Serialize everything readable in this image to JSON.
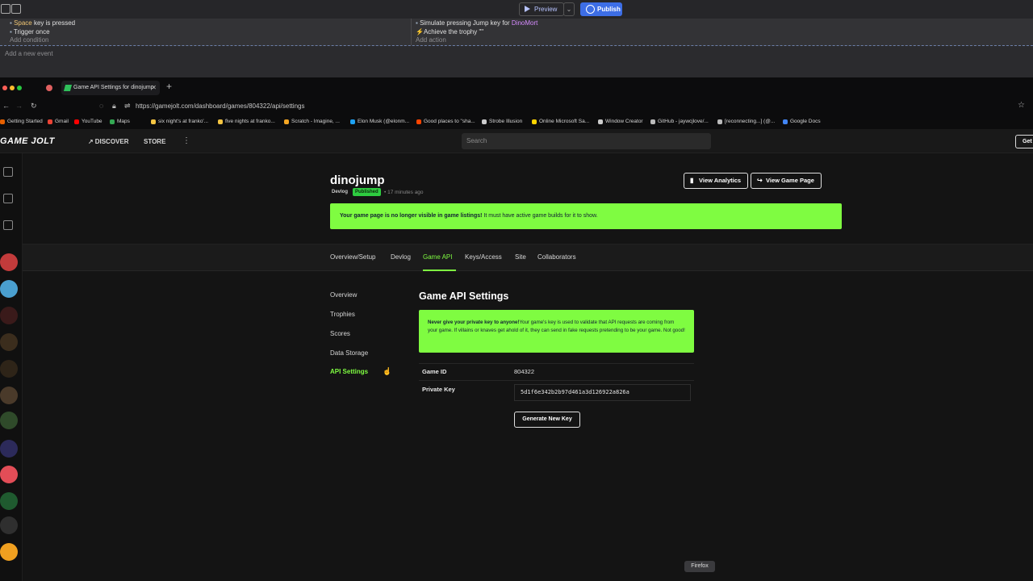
{
  "gdevelop": {
    "toolbar": {
      "preview_label": "Preview",
      "publish_label": "Publish"
    },
    "event": {
      "condition_key": "Space",
      "condition_text": "key is pressed",
      "condition_trigger": "Trigger once",
      "add_condition": "Add condition",
      "action_text": "Simulate pressing Jump key for",
      "action_object": "DinoMort",
      "action_trophy": "Achieve the trophy \"\"",
      "add_action": "Add action"
    },
    "add_event": "Add a new event"
  },
  "browser": {
    "tab_title": "Game API Settings for dinojump",
    "url": "https://gamejolt.com/dashboard/games/804322/api/settings",
    "bookmarks": [
      {
        "label": "Getting Started",
        "color": "#e66000"
      },
      {
        "label": "Gmail",
        "color": "#ea4335"
      },
      {
        "label": "YouTube",
        "color": "#ff0000"
      },
      {
        "label": "Maps",
        "color": "#34a853"
      },
      {
        "label": "six night's at franko'...",
        "color": "#f5c542"
      },
      {
        "label": "five nights at franko...",
        "color": "#f5c542"
      },
      {
        "label": "Scratch - Imagine, ...",
        "color": "#f5a623"
      },
      {
        "label": "Elon Musk (@elonm...",
        "color": "#1da1f2"
      },
      {
        "label": "Good places to \"sha...",
        "color": "#ff4500"
      },
      {
        "label": "Strobe Illusion",
        "color": "#cccccc"
      },
      {
        "label": "Online Microsoft Sa...",
        "color": "#ffd400"
      },
      {
        "label": "Window Creator",
        "color": "#cccccc"
      },
      {
        "label": "GitHub - jaywcjlove/...",
        "color": "#bbbbbb"
      },
      {
        "label": "[reconnecting...] (@...",
        "color": "#bbbbbb"
      },
      {
        "label": "Google Docs",
        "color": "#4285f4"
      }
    ],
    "tooltip": "Firefox"
  },
  "gamejolt": {
    "logo": "GAME JOLT",
    "nav": {
      "discover": "DISCOVER",
      "store": "STORE"
    },
    "search_placeholder": "Search",
    "get_app": "Get",
    "game": {
      "title": "dinojump",
      "tag_devlog": "Devlog",
      "tag_published": "Published",
      "time": "17 minutes ago"
    },
    "buttons": {
      "analytics": "View Analytics",
      "game_page": "View Game Page"
    },
    "alert": {
      "bold": "Your game page is no longer visible in game listings!",
      "text": " It must have active game builds for it to show."
    },
    "tabs": [
      "Overview/Setup",
      "Devlog",
      "Game API",
      "Keys/Access",
      "Site",
      "Collaborators"
    ],
    "side_nav": [
      "Overview",
      "Trophies",
      "Scores",
      "Data Storage",
      "API Settings"
    ],
    "api": {
      "title": "Game API Settings",
      "warning_bold": "Never give your private key to anyone!",
      "warning_text": "Your game's key is used to validate that API requests are coming from your game. If villains or knaves get ahold of it, they can send in fake requests pretending to be your game. Not good!",
      "game_id_label": "Game ID",
      "game_id": "804322",
      "private_key_label": "Private Key",
      "private_key": "5d1f6e342b2b97d461a3d126922a826a",
      "generate_label": "Generate New Key"
    }
  }
}
